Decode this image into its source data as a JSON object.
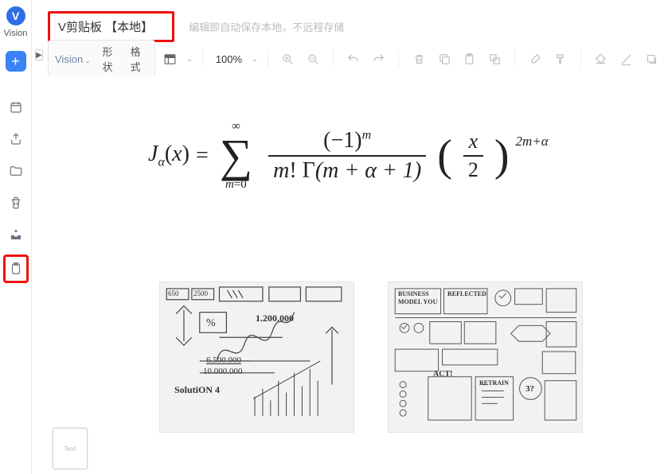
{
  "app": {
    "logo_letter": "V",
    "logo_label": "Vision"
  },
  "doc": {
    "title": "V剪贴板 【本地】",
    "hint": "编辑即自动保存本地，不远程存储"
  },
  "toolbar": {
    "vision_label": "Vision",
    "shape_label": "形状",
    "format_label": "格式",
    "zoom_label": "100%"
  },
  "rail": {
    "add": "+"
  },
  "thumb": {
    "label": "Text"
  },
  "formula": {
    "lhs_j": "J",
    "alpha": "α",
    "lparen": "(",
    "x": "x",
    "rparen": ")",
    "eq": "=",
    "sum_top": "∞",
    "sum_bot_m": "m",
    "sum_bot_eq": "=0",
    "num_neg1": "(−1)",
    "num_sup": "m",
    "den_mfact": "m",
    "den_excl": "!",
    "den_gamma": "Γ",
    "den_inner": "(m + α + 1)",
    "frac2_num": "x",
    "frac2_den": "2",
    "outer_exp": "2m+α"
  },
  "sketch": {
    "left": {
      "n1": "650",
      "n2": "2500",
      "pct": "%",
      "big": "1.200.000",
      "num": "6.500.000",
      "den": "10.000.000",
      "sol": "SolutiON 4"
    },
    "right": {
      "bus": "BUSINESS",
      "model": "MODEL YOU",
      "ref": "REFLECTED",
      "act": "ACT!",
      "retrain": "RETRAIN",
      "three": "3?"
    }
  }
}
